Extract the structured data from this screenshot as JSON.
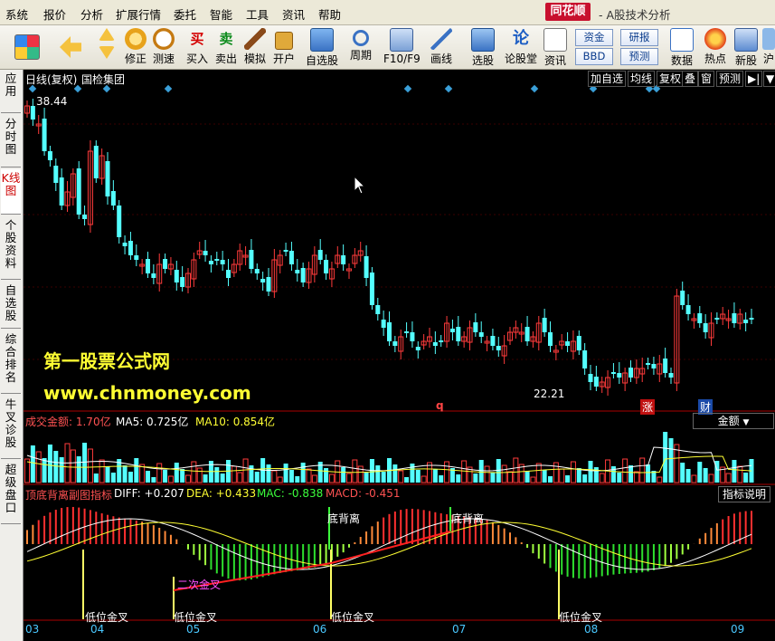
{
  "menu": {
    "items": [
      "系统",
      "报价",
      "分析",
      "扩展行情",
      "委托",
      "智能",
      "工具",
      "资讯",
      "帮助"
    ],
    "brand": "同花顺",
    "subtitle": "- A股技术分析"
  },
  "toolbar": {
    "buttons": [
      {
        "label": "修正",
        "icon": "fix-icon"
      },
      {
        "label": "测速",
        "icon": "speed-test-icon"
      },
      {
        "label": "买入",
        "icon": "buy-icon",
        "glyph": "买"
      },
      {
        "label": "卖出",
        "icon": "sell-icon",
        "glyph": "卖"
      },
      {
        "label": "模拟",
        "icon": "simulate-icon"
      },
      {
        "label": "开户",
        "icon": "open-account-icon"
      },
      {
        "label": "自选股",
        "icon": "watchlist-icon"
      },
      {
        "label": "周期",
        "icon": "period-icon"
      },
      {
        "label": "F10/F9",
        "icon": "f10-icon"
      },
      {
        "label": "画线",
        "icon": "draw-line-icon"
      },
      {
        "label": "选股",
        "icon": "stock-pick-icon"
      },
      {
        "label": "论股堂",
        "icon": "forum-icon",
        "glyph": "论"
      },
      {
        "label": "资讯",
        "icon": "news-icon"
      },
      {
        "label": "数据",
        "icon": "data-icon"
      },
      {
        "label": "热点",
        "icon": "hot-icon"
      },
      {
        "label": "新股",
        "icon": "ipo-icon"
      },
      {
        "label": "沪",
        "icon": "sh-icon"
      }
    ],
    "text_buttons": [
      "资金",
      "研报",
      "BBD",
      "预测"
    ]
  },
  "sidebar": {
    "tabs": [
      "应用",
      "分时图",
      "K线图",
      "个股资料",
      "自选股",
      "综合排名",
      "牛叉诊股",
      "超级盘口"
    ],
    "active": "K线图"
  },
  "kline": {
    "title": "日线(复权)",
    "stock_name": "国检集团",
    "buttons": [
      "加自选",
      "均线",
      "复权",
      "叠",
      "窗",
      "预测"
    ],
    "high_label": "38.44",
    "low_label": "22.21",
    "markers": [
      "q",
      "涨",
      "财"
    ],
    "colors": {
      "up": "#ff3b3b",
      "down": "#54ffff",
      "diamond": "#3a9fd8"
    }
  },
  "volume": {
    "title": "成交金额: 1.70亿",
    "ma5": "MA5: 0.725亿",
    "ma10": "MA10: 0.854亿",
    "selector": "金额"
  },
  "macd": {
    "title": "顶底背离副图指标",
    "diff": "DIFF: +0.207",
    "dea": "DEA: +0.433",
    "macd_green": "MAC: -0.838",
    "macd": "MACD: -0.451",
    "help": "指标说明",
    "signals": [
      "底背离",
      "底背离",
      "低位金叉",
      "二次金叉",
      "低位金叉",
      "低位金叉",
      "低位金叉"
    ]
  },
  "watermark": {
    "line1": "第一股票公式网",
    "line2": "www.chnmoney.com"
  },
  "x_axis": [
    "03",
    "04",
    "05",
    "06",
    "07",
    "08",
    "09"
  ]
}
